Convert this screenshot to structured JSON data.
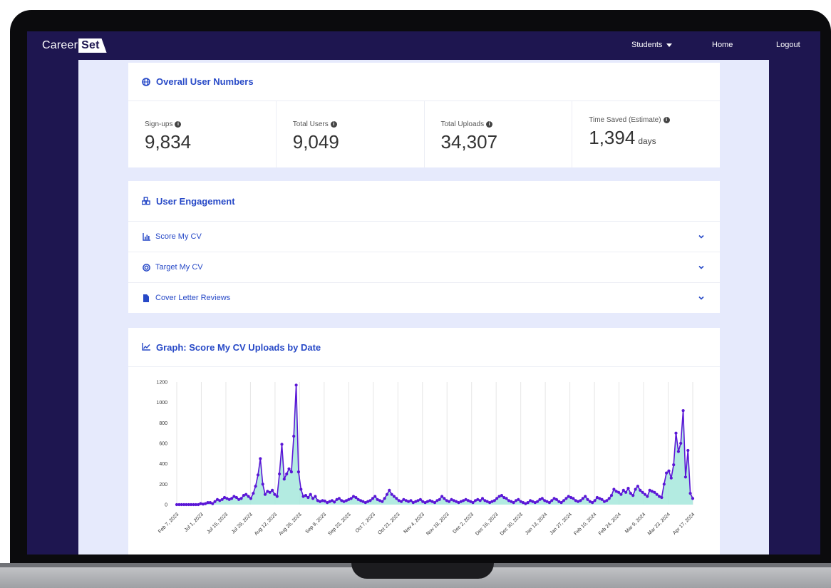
{
  "app": {
    "brand_main": "Career",
    "brand_box": "Set"
  },
  "nav": {
    "students": "Students",
    "home": "Home",
    "logout": "Logout"
  },
  "overall": {
    "title": "Overall User Numbers",
    "stats": [
      {
        "label": "Sign-ups",
        "value": "9,834",
        "unit": ""
      },
      {
        "label": "Total Users",
        "value": "9,049",
        "unit": ""
      },
      {
        "label": "Total Uploads",
        "value": "34,307",
        "unit": ""
      },
      {
        "label": "Time Saved (Estimate)",
        "value": "1,394",
        "unit": "days"
      }
    ]
  },
  "engagement": {
    "title": "User Engagement",
    "items": [
      {
        "label": "Score My CV",
        "icon": "bar-chart-icon"
      },
      {
        "label": "Target My CV",
        "icon": "target-icon"
      },
      {
        "label": "Cover Letter Reviews",
        "icon": "file-icon"
      }
    ]
  },
  "graph": {
    "title": "Graph: Score My CV Uploads by Date"
  },
  "colors": {
    "nav": "#1e1650",
    "accent": "#2749c7",
    "line": "#5a16d6",
    "fill": "#a6e8dc",
    "page_bg": "#e6eafc"
  },
  "chart_data": {
    "type": "area",
    "title": "",
    "xlabel": "",
    "ylabel": "",
    "ylim": [
      0,
      1200
    ],
    "yticks": [
      0,
      200,
      400,
      600,
      800,
      1000,
      1200
    ],
    "xtick_labels": [
      "Feb 7, 2023",
      "Jul 1, 2023",
      "Jul 15, 2023",
      "Jul 29, 2023",
      "Aug 12, 2023",
      "Aug 26, 2023",
      "Sep 9, 2023",
      "Sep 23, 2023",
      "Oct 7, 2023",
      "Oct 21, 2023",
      "Nov 4, 2023",
      "Nov 18, 2023",
      "Dec 2, 2023",
      "Dec 16, 2023",
      "Dec 30, 2023",
      "Jan 13, 2024",
      "Jan 27, 2024",
      "Feb 10, 2024",
      "Feb 24, 2024",
      "Mar 9, 2024",
      "Mar 23, 2024",
      "Apr 17, 2024"
    ],
    "grid": true,
    "series": [
      {
        "values": [
          0,
          0,
          0,
          0,
          0,
          0,
          0,
          0,
          0,
          0,
          10,
          5,
          10,
          20,
          20,
          10,
          30,
          50,
          40,
          50,
          70,
          60,
          50,
          60,
          80,
          70,
          50,
          60,
          90,
          100,
          80,
          60,
          110,
          180,
          290,
          450,
          200,
          100,
          130,
          120,
          140,
          100,
          80,
          300,
          590,
          250,
          300,
          350,
          320,
          670,
          1170,
          320,
          150,
          80,
          90,
          70,
          100,
          60,
          80,
          40,
          30,
          40,
          35,
          20,
          30,
          40,
          25,
          50,
          60,
          40,
          30,
          40,
          50,
          60,
          80,
          70,
          50,
          40,
          30,
          20,
          30,
          40,
          60,
          80,
          50,
          40,
          30,
          60,
          100,
          140,
          100,
          80,
          60,
          40,
          30,
          50,
          40,
          30,
          40,
          20,
          30,
          40,
          50,
          30,
          20,
          30,
          40,
          30,
          20,
          40,
          50,
          80,
          60,
          40,
          30,
          50,
          40,
          30,
          20,
          30,
          40,
          50,
          40,
          30,
          20,
          40,
          50,
          40,
          60,
          40,
          30,
          20,
          30,
          40,
          60,
          80,
          90,
          70,
          60,
          40,
          30,
          20,
          40,
          50,
          30,
          20,
          10,
          20,
          40,
          30,
          20,
          30,
          50,
          60,
          40,
          30,
          20,
          40,
          60,
          50,
          30,
          20,
          40,
          60,
          80,
          70,
          60,
          40,
          30,
          40,
          60,
          80,
          50,
          30,
          20,
          40,
          70,
          60,
          50,
          30,
          40,
          60,
          90,
          150,
          130,
          120,
          100,
          140,
          120,
          160,
          110,
          90,
          150,
          180,
          140,
          120,
          100,
          80,
          140,
          130,
          120,
          100,
          80,
          70,
          200,
          310,
          330,
          260,
          390,
          700,
          520,
          600,
          920,
          270,
          530,
          110,
          60
        ]
      }
    ]
  }
}
